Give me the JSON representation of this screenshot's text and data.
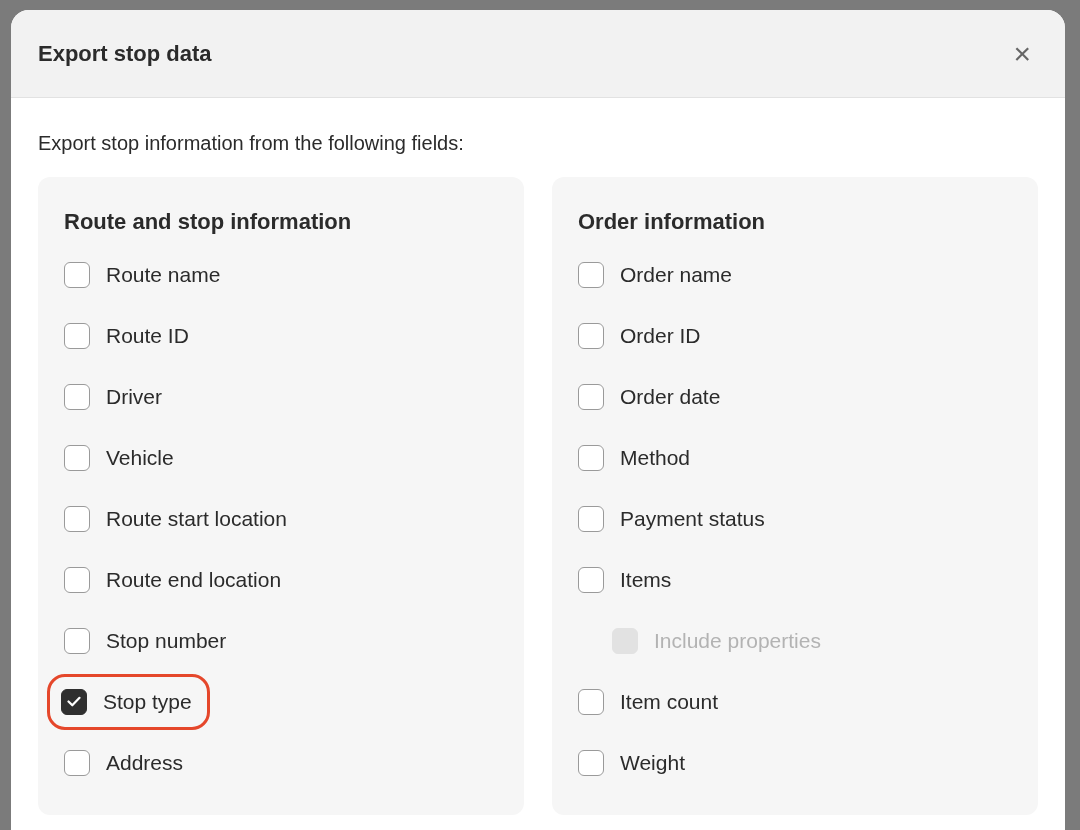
{
  "dialog": {
    "title": "Export stop data",
    "close": "×",
    "intro": "Export stop information from the following fields:",
    "groups": [
      {
        "title": "Route and stop information",
        "fields": [
          {
            "label": "Route name",
            "checked": false,
            "disabled": false,
            "highlighted": false
          },
          {
            "label": "Route ID",
            "checked": false,
            "disabled": false,
            "highlighted": false
          },
          {
            "label": "Driver",
            "checked": false,
            "disabled": false,
            "highlighted": false
          },
          {
            "label": "Vehicle",
            "checked": false,
            "disabled": false,
            "highlighted": false
          },
          {
            "label": "Route start location",
            "checked": false,
            "disabled": false,
            "highlighted": false
          },
          {
            "label": "Route end location",
            "checked": false,
            "disabled": false,
            "highlighted": false
          },
          {
            "label": "Stop number",
            "checked": false,
            "disabled": false,
            "highlighted": false
          },
          {
            "label": "Stop type",
            "checked": true,
            "disabled": false,
            "highlighted": true
          },
          {
            "label": "Address",
            "checked": false,
            "disabled": false,
            "highlighted": false
          }
        ]
      },
      {
        "title": "Order information",
        "fields": [
          {
            "label": "Order name",
            "checked": false,
            "disabled": false,
            "highlighted": false
          },
          {
            "label": "Order ID",
            "checked": false,
            "disabled": false,
            "highlighted": false
          },
          {
            "label": "Order date",
            "checked": false,
            "disabled": false,
            "highlighted": false
          },
          {
            "label": "Method",
            "checked": false,
            "disabled": false,
            "highlighted": false
          },
          {
            "label": "Payment status",
            "checked": false,
            "disabled": false,
            "highlighted": false
          },
          {
            "label": "Items",
            "checked": false,
            "disabled": false,
            "highlighted": false,
            "children": [
              {
                "label": "Include properties",
                "checked": false,
                "disabled": true,
                "highlighted": false
              }
            ]
          },
          {
            "label": "Item count",
            "checked": false,
            "disabled": false,
            "highlighted": false
          },
          {
            "label": "Weight",
            "checked": false,
            "disabled": false,
            "highlighted": false
          }
        ]
      }
    ]
  }
}
